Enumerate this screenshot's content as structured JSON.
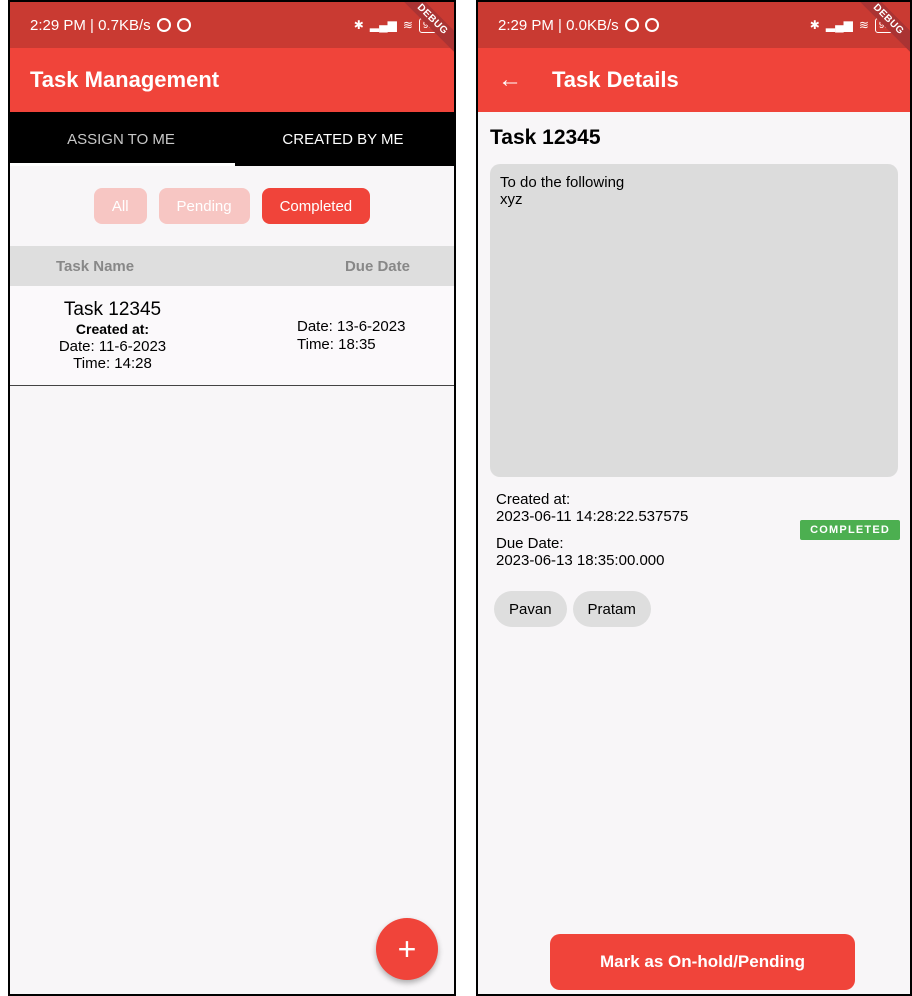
{
  "left_screen": {
    "status": {
      "time": "2:29 PM | 0.7KB/s",
      "debug_label": "DEBUG",
      "battery": "93"
    },
    "appbar_title": "Task Management",
    "tabs": [
      {
        "label": "ASSIGN TO ME",
        "active": false
      },
      {
        "label": "CREATED BY ME",
        "active": true
      }
    ],
    "filters": [
      {
        "label": "All",
        "active": false
      },
      {
        "label": "Pending",
        "active": false
      },
      {
        "label": "Completed",
        "active": true
      }
    ],
    "table": {
      "col_name": "Task Name",
      "col_due": "Due Date",
      "rows": [
        {
          "name": "Task 12345",
          "created_label": "Created at:",
          "created_date": "Date: 11-6-2023",
          "created_time": "Time: 14:28",
          "due_date": "Date: 13-6-2023",
          "due_time": "Time: 18:35"
        }
      ]
    },
    "fab_icon": "+"
  },
  "right_screen": {
    "status": {
      "time": "2:29 PM | 0.0KB/s",
      "debug_label": "DEBUG",
      "battery": "93"
    },
    "appbar_title": "Task Details",
    "back_icon": "←",
    "task_title": "Task 12345",
    "description": [
      "To do the following",
      "xyz"
    ],
    "created_label": "Created at:",
    "created_value": "2023-06-11 14:28:22.537575",
    "due_label": "Due Date:",
    "due_value": "2023-06-13 18:35:00.000",
    "status_badge": "COMPLETED",
    "assignees": [
      "Pavan",
      "Pratam"
    ],
    "action_button": "Mark as On-hold/Pending"
  },
  "colors": {
    "primary": "#f0443a",
    "statusbar": "#c93a32",
    "completed": "#4caf50"
  }
}
